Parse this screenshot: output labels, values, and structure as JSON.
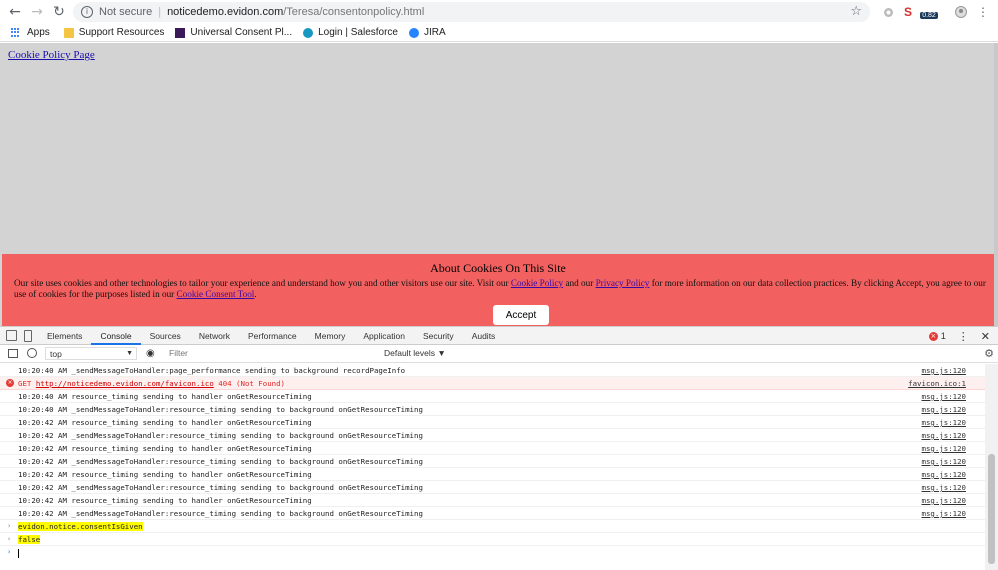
{
  "browser": {
    "security_label": "Not secure",
    "url_host": "noticedemo.evidon.com",
    "url_path": "/Teresa/consentonpolicy.html",
    "extension_badge": "0.82",
    "bookmarks": [
      {
        "label": "Apps"
      },
      {
        "label": "Support Resources"
      },
      {
        "label": "Universal Consent Pl..."
      },
      {
        "label": "Login | Salesforce"
      },
      {
        "label": "JIRA"
      }
    ]
  },
  "page": {
    "link": "Cookie Policy Page",
    "banner": {
      "title": "About Cookies On This Site",
      "text_1": "Our site uses cookies and other technologies to tailor your experience and understand how you and other visitors use our site. Visit our ",
      "link_cookie_policy": "Cookie Policy",
      "text_2": " and our ",
      "link_privacy_policy": "Privacy Policy",
      "text_3": " for more information on our data collection practices. By clicking Accept, you agree to our use of cookies for the purposes listed in our ",
      "link_consent_tool": "Cookie Consent Tool",
      "text_4": ".",
      "accept_label": "Accept",
      "bg_color": "#f26060"
    }
  },
  "devtools": {
    "tabs": [
      "Elements",
      "Console",
      "Sources",
      "Network",
      "Performance",
      "Memory",
      "Application",
      "Security",
      "Audits"
    ],
    "active_tab": "Console",
    "error_count": "1",
    "context": "top",
    "filter_placeholder": "Filter",
    "levels": "Default levels ▼",
    "logs": [
      {
        "text": "10:20:40 AM  _sendMessageToHandler:page_performance sending to background recordPageInfo",
        "src": "msg.js:120"
      },
      {
        "text_prefix": "GET ",
        "link": "http://noticedemo.evidon.com/favicon.ico",
        "text_suffix": " 404 (Not Found)",
        "src": "favicon.ico:1",
        "type": "error"
      },
      {
        "text": "10:20:40 AM  resource_timing sending to handler onGetResourceTiming",
        "src": "msg.js:120"
      },
      {
        "text": "10:20:40 AM  _sendMessageToHandler:resource_timing sending to background onGetResourceTiming",
        "src": "msg.js:120"
      },
      {
        "text": "10:20:42 AM  resource_timing sending to handler onGetResourceTiming",
        "src": "msg.js:120"
      },
      {
        "text": "10:20:42 AM  _sendMessageToHandler:resource_timing sending to background onGetResourceTiming",
        "src": "msg.js:120"
      },
      {
        "text": "10:20:42 AM  resource_timing sending to handler onGetResourceTiming",
        "src": "msg.js:120"
      },
      {
        "text": "10:20:42 AM  _sendMessageToHandler:resource_timing sending to background onGetResourceTiming",
        "src": "msg.js:120"
      },
      {
        "text": "10:20:42 AM  resource_timing sending to handler onGetResourceTiming",
        "src": "msg.js:120"
      },
      {
        "text": "10:20:42 AM  _sendMessageToHandler:resource_timing sending to background onGetResourceTiming",
        "src": "msg.js:120"
      },
      {
        "text": "10:20:42 AM  resource_timing sending to handler onGetResourceTiming",
        "src": "msg.js:120"
      },
      {
        "text": "10:20:42 AM  _sendMessageToHandler:resource_timing sending to background onGetResourceTiming",
        "src": "msg.js:120"
      }
    ],
    "command": "evidon.notice.consentIsGiven",
    "result": "false"
  }
}
